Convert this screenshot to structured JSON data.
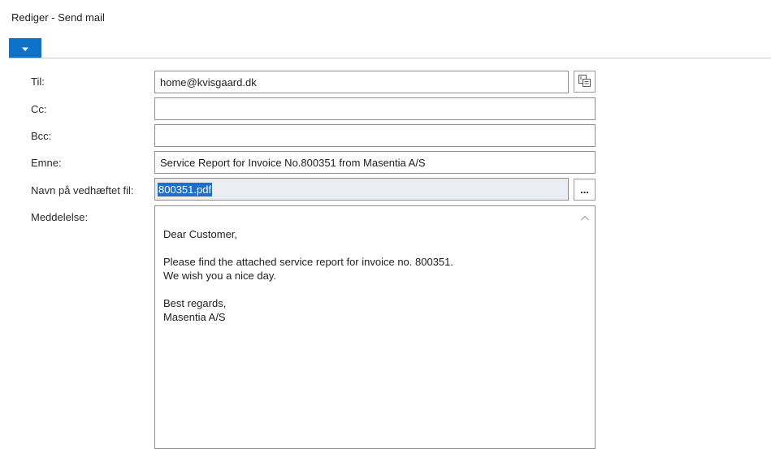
{
  "window": {
    "title": "Rediger - Send mail"
  },
  "ribbon": {
    "toggle_icon": "chevron-down-icon",
    "accent_color": "#0e72c8"
  },
  "form": {
    "to": {
      "label": "Til:",
      "value": "home@kvisgaard.dk"
    },
    "cc": {
      "label": "Cc:",
      "value": ""
    },
    "bcc": {
      "label": "Bcc:",
      "value": ""
    },
    "subject": {
      "label": "Emne:",
      "value": "Service Report for Invoice No.800351 from Masentia A/S"
    },
    "attachment": {
      "label": "Navn på vedhæftet fil:",
      "value": "800351.pdf",
      "browse_label": "..."
    },
    "message": {
      "label": "Meddelelse:",
      "greeting": "Dear Customer,",
      "body_line1": "Please find the attached service report for invoice no. 800351.",
      "body_line2": "We wish you a nice day.",
      "closing": "Best regards,",
      "signature": "Masentia A/S"
    }
  },
  "icons": {
    "address_book": "address-book-icon",
    "scroll_up": "scroll-up-arrow-icon"
  }
}
